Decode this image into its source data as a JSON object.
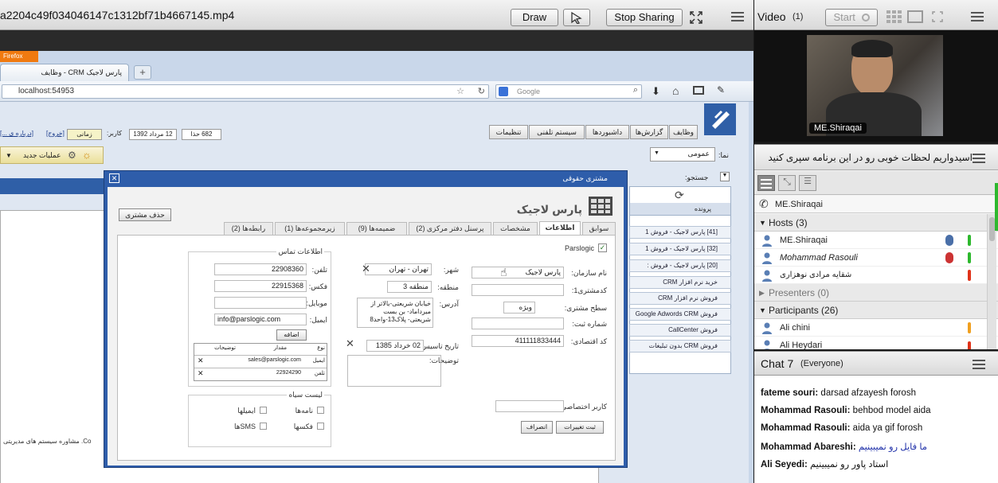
{
  "share": {
    "title": "a2204c49f034046147c1312bf71b4667145.mp4",
    "draw_label": "Draw",
    "stop_label": "Stop Sharing"
  },
  "browser": {
    "tab_title": "پارس لاجیک CRM - وظایف",
    "address": "localhost:54953",
    "search_placeholder": "Google",
    "firefox_label": "Firefox"
  },
  "crm": {
    "nav_tabs": [
      "وظایف",
      "گزارش‌ها",
      "داشبوردها",
      "سیستم تلفنی",
      "تنظیمات"
    ],
    "topbar": {
      "count": "682 حذا",
      "date": "12 مرداد 1392",
      "user_label": "کاربر:",
      "user": "زمانی",
      "help": "[خروج]",
      "about": "[درباره ی ...]"
    },
    "ops_label": "عملیات جدید",
    "filter_label": "نما:",
    "filter_value": "عمومی",
    "search_label": "جستجو:",
    "list_header": "پرونده",
    "left_footer": "Co. مشاوره سیستم های مدیریتی",
    "list_items": [
      "[41] پارس لاجیک - فروش 1",
      "[32] پارس لاجیک - فروش 1",
      "[20] پارس لاجیک - فروش :",
      "خرید نرم افزار CRM",
      "فروش نرم افزار CRM",
      "فروش Google Adwords CRM",
      "فروش CallCenter",
      "فروش CRM بدون تبلیغات"
    ]
  },
  "dialog": {
    "title": "مشتری حقوقی",
    "company": "پارس لاجیک",
    "delete_btn": "حذف مشتری",
    "tabs": [
      "سوابق",
      "اطلاعات",
      "مشخصات",
      "پرسنل دفتر مرکزی (2)",
      "ضمیمه‌ها (9)",
      "زیرمجموعه‌ها (1)",
      "رابطه‌ها (2)"
    ],
    "parslogic_check": "Parslogic",
    "fields": {
      "org_name_label": "نام سازمان:",
      "org_name": "پارس لاجیک",
      "eco_label": "کدمشتری1:",
      "level_label": "سطح مشتری:",
      "level": "ویژه",
      "reg_label": "شماره ثبت:",
      "eco_code_label": "کد اقتصادی:",
      "eco_code": "411111833444",
      "private_label": "کاربر اختصاصی:",
      "city_label": "شهر:",
      "city": "تهران - تهران",
      "region_label": "منطقه:",
      "region": "منطقه 3",
      "address_label": "آدرس:",
      "address": "خیابان شریعتی-بالاتر از میرداماد- بن بست شریعتی- پلاک13-واحد8",
      "found_label": "تاریخ تاسیس:",
      "found": "02 خرداد 1385",
      "desc_label": "توضیحات:"
    },
    "contact": {
      "legend": "اطلاعات تماس",
      "tel_label": "تلفن:",
      "tel": "22908360",
      "fax_label": "فکس:",
      "fax": "22915368",
      "mobile_label": "موبایل:",
      "email_label": "ایمیل:",
      "email": "info@parslogic.com",
      "add_btn": "اضافه",
      "table_headers": [
        "نوع",
        "مقدار",
        "توضیحات"
      ],
      "table_rows": [
        [
          "ایمیل",
          "sales@parslogic.com",
          ""
        ],
        [
          "تلفن",
          "22924290",
          ""
        ]
      ]
    },
    "blacklist": {
      "legend": "لیست سیاه",
      "items": [
        "نامه‌ها",
        "ایمیلها",
        "فکسها",
        "SMSها"
      ]
    },
    "save_btn": "ثبت تغییرات",
    "cancel_btn": "انصراف"
  },
  "video": {
    "title": "Video",
    "count": "(1)",
    "start_label": "Start",
    "presenter_name": "ME.Shiraqai"
  },
  "attendees": {
    "banner": "اسیدواریم لحظات خوبی رو در این برنامه سپری کنید",
    "speaker": "ME.Shiraqai",
    "hosts_label": "Hosts (3)",
    "hosts": [
      "ME.Shiraqai",
      "Mohammad Rasouli",
      "شقایه مرادی نوهزاری"
    ],
    "presenters_label": "Presenters (0)",
    "participants_label": "Participants (26)",
    "participants": [
      "Ali chini",
      "Ali Heydari"
    ]
  },
  "chat": {
    "title": "Chat 7",
    "scope": "(Everyone)",
    "messages": [
      {
        "name": "fateme souri:",
        "text": "darsad afzayesh forosh"
      },
      {
        "name": "Mohammad Rasouli:",
        "text": "behbod model aida"
      },
      {
        "name": "Mohammad Rasouli:",
        "text": "aida ya gif forosh"
      },
      {
        "name": "Mohammad Abareshi:",
        "text": "ما فایل رو نمیبینیم"
      },
      {
        "name": "Ali Seyedi:",
        "text": "استاد پاور رو نمیبینیم"
      }
    ]
  },
  "colors": {
    "accent_green": "#2eb82e",
    "accent_red": "#e0331a",
    "accent_orange": "#f0a020",
    "header_blue": "#2f5fa7"
  }
}
